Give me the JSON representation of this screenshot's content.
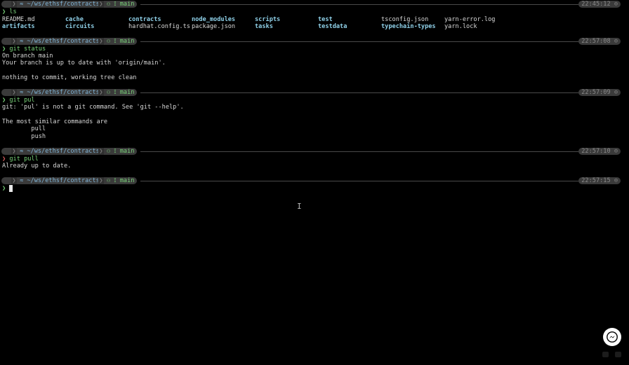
{
  "prompt_segments": {
    "os": "",
    "path": "≈ ~/ws/ethsf/contracts",
    "git_branch": "⚇ ⟟ main"
  },
  "blocks": [
    {
      "time": "22:45:12 ⊙",
      "command": "ls",
      "ls": {
        "row1": [
          "README.md",
          "cache",
          "contracts",
          "node_modules",
          "scripts",
          "test",
          "tsconfig.json",
          "yarn-error.log"
        ],
        "row2": [
          "artifacts",
          "circuits",
          "hardhat.config.ts",
          "package.json",
          "tasks",
          "testdata",
          "typechain-types",
          "yarn.lock"
        ]
      }
    },
    {
      "time": "22:57:08 ⊙",
      "command": "git status",
      "output": [
        "On branch main",
        "Your branch is up to date with 'origin/main'.",
        "",
        "nothing to commit, working tree clean"
      ]
    },
    {
      "time": "22:57:09 ⊙",
      "command": "git pul",
      "output": [
        "git: 'pul' is not a git command. See 'git --help'.",
        "",
        "The most similar commands are",
        "        pull",
        "        push"
      ]
    },
    {
      "time": "22:57:10 ⊙",
      "command": "git pull",
      "output": [
        "Already up to date."
      ]
    },
    {
      "time": "22:57:15 ⊙",
      "command": ""
    }
  ],
  "prompt_char": "❯"
}
